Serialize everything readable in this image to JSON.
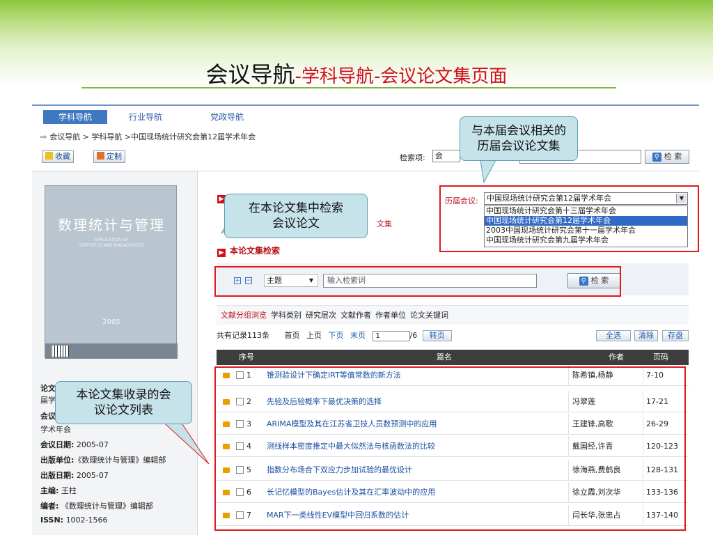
{
  "slide": {
    "title_main": "会议导航",
    "title_sub": "-学科导航-会议论文集页面"
  },
  "nav": {
    "tabs": [
      "学科导航",
      "行业导航",
      "党政导航"
    ],
    "breadcrumb": "会议导航 > 学科导航 >中国现场统计研究会第12届学术年会"
  },
  "toolbar": {
    "favorite": "收藏",
    "customize": "定制",
    "search_label": "检索项:",
    "search_field": "会",
    "search_button": "检 索"
  },
  "callouts": {
    "history": "与本届会议相关的\n历届会议论文集",
    "search_in": "在本论文集中检索\n会议论文",
    "list": "本论文集收录的会\n议论文列表"
  },
  "history": {
    "label": "历届会议:",
    "selected": "中国现场统计研究会第12届学术年会",
    "options": [
      "中国现场统计研究会第十三届学术年会",
      "中国现场统计研究会第12届学术年会",
      "2003中国现场统计研究会第十一届学术年会",
      "中国现场统计研究会第九届学术年会"
    ]
  },
  "sections": {
    "first_head_tail": "文集",
    "search_head": "本论文集检索"
  },
  "cover": {
    "title": "数理统计与管理",
    "subtitle_en1": "APPLICATION OF",
    "subtitle_en2": "STATISTICS AND MANAGEMENT",
    "year": "2005"
  },
  "meta": {
    "paper_label": "论文",
    "session_prefix": "届学",
    "conf_label": "会议",
    "conf_value_tail": "学术年会",
    "date_label": "会议日期:",
    "date_value": "2005-07",
    "publisher_label": "出版单位:",
    "publisher_value": "《数理统计与管理》编辑部",
    "pubdate_label": "出版日期:",
    "pubdate_value": "2005-07",
    "editor_label": "主编:",
    "editor_value": "王柱",
    "compiler_label": "编者:",
    "compiler_value": "《数理统计与管理》编辑部",
    "issn_label": "ISSN:",
    "issn_value": "1002-1566"
  },
  "search": {
    "field": "主题",
    "placeholder": "输入检索词",
    "button": "检 索"
  },
  "group_browse": {
    "items": [
      "文献分组浏览",
      "学科类别",
      "研究层次",
      "文献作者",
      "作者单位",
      "论文关键词"
    ]
  },
  "pager": {
    "total": "共有记录113条",
    "first": "首页",
    "prev": "上页",
    "next": "下页",
    "last": "末页",
    "current": "1",
    "of": "/6",
    "go": "转页",
    "select_all": "全选",
    "clear": "清除",
    "save": "存盘"
  },
  "table": {
    "headers": [
      "序号",
      "篇名",
      "作者",
      "页码"
    ],
    "rows": [
      {
        "num": "1",
        "title": "锥测验设计下确定IRT等值常数的新方法",
        "author": "陈希镇,杨静",
        "pages": "7-10"
      },
      {
        "num": "2",
        "title": "先验及后验概率下最优决策的选择",
        "author": "冯翠莲",
        "pages": "17-21"
      },
      {
        "num": "3",
        "title": "ARIMA模型及其在江苏省卫技人员数预测中的应用",
        "author": "王建锋,高歌",
        "pages": "26-29"
      },
      {
        "num": "4",
        "title": "测线样本密度推定中最大似然法与核函数法的比较",
        "author": "戴国经,许青",
        "pages": "120-123"
      },
      {
        "num": "5",
        "title": "指数分布场合下双应力步加试验的最优设计",
        "author": "徐海燕,费鹤良",
        "pages": "128-131"
      },
      {
        "num": "6",
        "title": "长记忆模型的Bayes估计及其在汇率波动中的应用",
        "author": "徐立霞,刘次华",
        "pages": "133-136"
      },
      {
        "num": "7",
        "title": "MAR下一类线性EV模型中回归系数的估计",
        "author": "闫长华,张忠占",
        "pages": "137-140"
      }
    ]
  }
}
